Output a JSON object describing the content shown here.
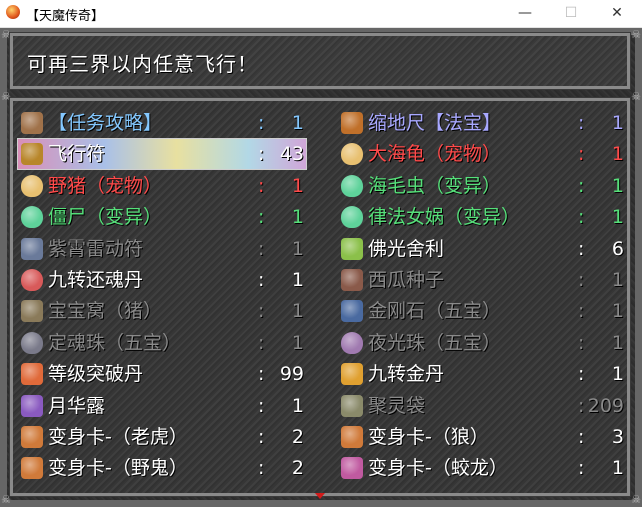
{
  "window": {
    "title": "【天魔传奇】",
    "min_icon": "minimize-icon",
    "max_icon": "maximize-icon",
    "close_icon": "close-icon"
  },
  "message": "可再三界以内任意飞行！",
  "items": [
    {
      "name": "【任务攻略】",
      "count": "1",
      "color": "#84c8ff",
      "icon": "scroll-icon",
      "icon_color": "#a0724a"
    },
    {
      "name": "缩地尺【法宝】",
      "count": "1",
      "color": "#a8a8ff",
      "icon": "ruler-icon",
      "icon_color": "#c0702a"
    },
    {
      "name": "飞行符",
      "count": "43",
      "color": "#ffffff",
      "icon": "talisman-book-icon",
      "icon_color": "#b8862a"
    },
    {
      "name": "大海龟（宠物）",
      "count": "1",
      "color": "#ff4a4a",
      "icon": "egg-icon",
      "icon_color": "#e8c070"
    },
    {
      "name": "野猪（宠物）",
      "count": "1",
      "color": "#ff4a4a",
      "icon": "egg-icon",
      "icon_color": "#e8c070"
    },
    {
      "name": "海毛虫（变异）",
      "count": "1",
      "color": "#56e07a",
      "icon": "green-egg-icon",
      "icon_color": "#5ed29a"
    },
    {
      "name": "僵尸（变异）",
      "count": "1",
      "color": "#56e07a",
      "icon": "green-egg-icon",
      "icon_color": "#5ed29a"
    },
    {
      "name": "律法女娲（变异）",
      "count": "1",
      "color": "#56e07a",
      "icon": "green-egg-icon",
      "icon_color": "#5ed29a"
    },
    {
      "name": "紫霄雷动符",
      "count": "1",
      "color": "#8a8a8a",
      "icon": "talisman-icon",
      "icon_color": "#6a7a9a"
    },
    {
      "name": "佛光舍利",
      "count": "6",
      "color": "#ffffff",
      "icon": "relic-icon",
      "icon_color": "#8bc04a"
    },
    {
      "name": "九转还魂丹",
      "count": "1",
      "color": "#ffffff",
      "icon": "pill-orb-icon",
      "icon_color": "#d85a5a"
    },
    {
      "name": "西瓜种子",
      "count": "1",
      "color": "#8a8a8a",
      "icon": "seed-icon",
      "icon_color": "#8a5a4a"
    },
    {
      "name": "宝宝窝（猪）",
      "count": "1",
      "color": "#8a8a8a",
      "icon": "nest-icon",
      "icon_color": "#8a7a5a"
    },
    {
      "name": "金刚石（五宝）",
      "count": "1",
      "color": "#8a8a8a",
      "icon": "stone-icon",
      "icon_color": "#4a6aa0"
    },
    {
      "name": "定魂珠（五宝）",
      "count": "1",
      "color": "#8a8a8a",
      "icon": "pearl-icon",
      "icon_color": "#7a7a8a"
    },
    {
      "name": "夜光珠（五宝）",
      "count": "1",
      "color": "#8a8a8a",
      "icon": "pearl-icon",
      "icon_color": "#a07ab0"
    },
    {
      "name": "等级突破丹",
      "count": "99",
      "color": "#ffffff",
      "icon": "pill-icon",
      "icon_color": "#e06a3a"
    },
    {
      "name": "九转金丹",
      "count": "1",
      "color": "#ffffff",
      "icon": "gold-pill-icon",
      "icon_color": "#e0a030"
    },
    {
      "name": "月华露",
      "count": "1",
      "color": "#ffffff",
      "icon": "bottle-icon",
      "icon_color": "#8a5ac0"
    },
    {
      "name": "聚灵袋",
      "count": "209",
      "color": "#8a8a8a",
      "icon": "bag-icon",
      "icon_color": "#8a8a6a"
    },
    {
      "name": "变身卡-（老虎）",
      "count": "2",
      "color": "#ffffff",
      "icon": "card-icon",
      "icon_color": "#d07a3a"
    },
    {
      "name": "变身卡-（狼）",
      "count": "3",
      "color": "#ffffff",
      "icon": "card-icon",
      "icon_color": "#d07a3a"
    },
    {
      "name": "变身卡-（野鬼）",
      "count": "2",
      "color": "#ffffff",
      "icon": "card-icon",
      "icon_color": "#d07a3a"
    },
    {
      "name": "变身卡-（蛟龙）",
      "count": "1",
      "color": "#ffffff",
      "icon": "card-icon",
      "icon_color": "#c05aa0"
    }
  ],
  "selected_index": 2,
  "colon": ":"
}
